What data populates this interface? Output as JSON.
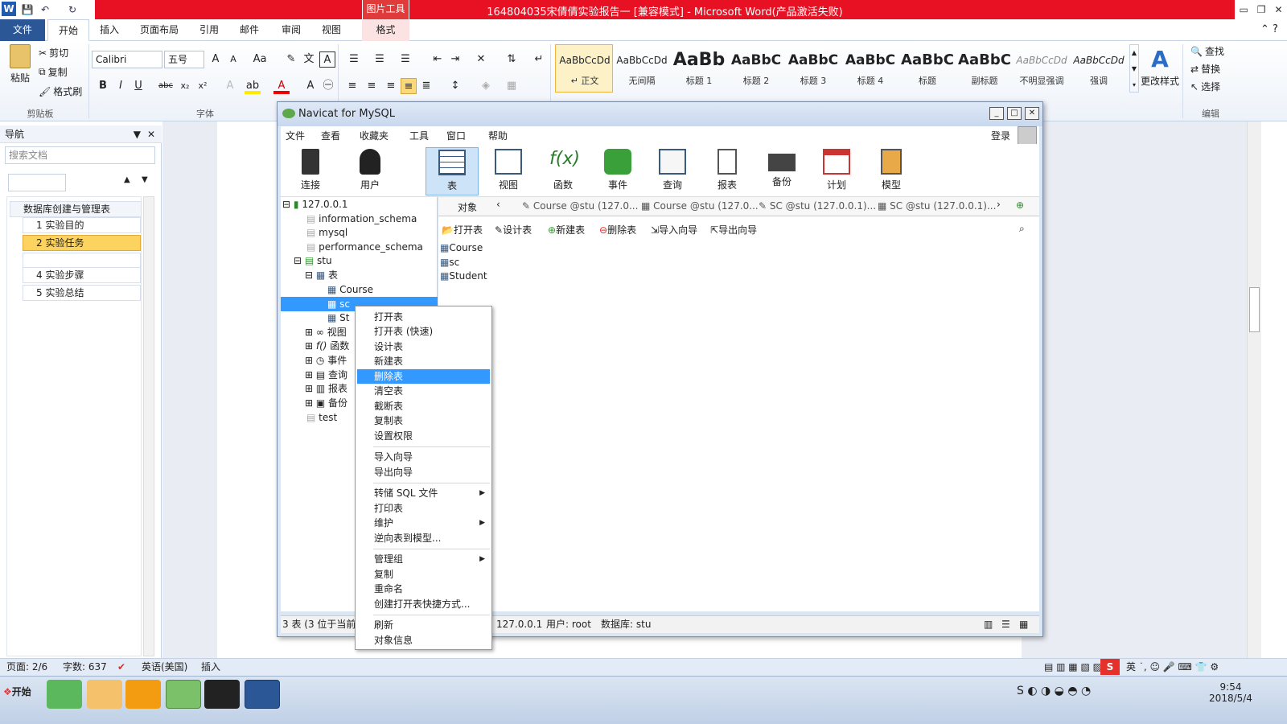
{
  "word": {
    "title": "164804035宋倩倩实验报告一 [兼容模式] - Microsoft Word(产品激活失败)",
    "picture_tools": "图片工具",
    "tabs": [
      "文件",
      "开始",
      "插入",
      "页面布局",
      "引用",
      "邮件",
      "审阅",
      "视图",
      "格式"
    ],
    "clipboard": {
      "paste": "粘贴",
      "cut": "剪切",
      "copy": "复制",
      "painter": "格式刷",
      "label": "剪贴板"
    },
    "font": {
      "name": "Calibri",
      "size": "五号",
      "label": "字体"
    },
    "styles": [
      {
        "preview": "AaBbCcDd",
        "name": "↵ 正文"
      },
      {
        "preview": "AaBbCcDd",
        "name": "无间隔"
      },
      {
        "preview": "AaBb",
        "name": "标题 1"
      },
      {
        "preview": "AaBbC",
        "name": "标题 2"
      },
      {
        "preview": "AaBbC",
        "name": "标题 3"
      },
      {
        "preview": "AaBbC",
        "name": "标题 4"
      },
      {
        "preview": "AaBbC",
        "name": "标题"
      },
      {
        "preview": "AaBbC",
        "name": "副标题"
      },
      {
        "preview": "AaBbCcDd",
        "name": "不明显强调"
      },
      {
        "preview": "AaBbCcDd",
        "name": "强调"
      }
    ],
    "change_styles": "更改样式",
    "editing": {
      "find": "查找",
      "replace": "替换",
      "select": "选择",
      "label": "编辑"
    },
    "nav": {
      "title": "导航",
      "search_placeholder": "搜索文档",
      "items": [
        "数据库创建与管理表",
        "1 实验目的",
        "2 实验任务",
        "",
        "4 实验步骤",
        "5 实验总结"
      ]
    },
    "status": {
      "page": "页面: 2/6",
      "words": "字数: 637",
      "lang": "英语(美国)",
      "mode": "插入"
    },
    "clock": {
      "time": "9:54",
      "date": "2018/5/4"
    },
    "start": "开始"
  },
  "navicat": {
    "title": "Navicat for MySQL",
    "login": "登录",
    "menu": [
      "文件",
      "查看",
      "收藏夹",
      "工具",
      "窗口",
      "帮助"
    ],
    "toolbar": [
      "连接",
      "用户",
      "表",
      "视图",
      "函数",
      "事件",
      "查询",
      "报表",
      "备份",
      "计划",
      "模型"
    ],
    "tree": [
      {
        "label": "127.0.0.1"
      },
      {
        "label": "information_schema"
      },
      {
        "label": "mysql"
      },
      {
        "label": "performance_schema"
      },
      {
        "label": "stu"
      },
      {
        "label": "表"
      },
      {
        "label": "Course"
      },
      {
        "label": "sc"
      },
      {
        "label": "St"
      },
      {
        "label": "视图"
      },
      {
        "label": "函数"
      },
      {
        "label": "事件"
      },
      {
        "label": "查询"
      },
      {
        "label": "报表"
      },
      {
        "label": "备份"
      },
      {
        "label": "test"
      }
    ],
    "tabs": [
      "对象",
      "Course @stu (127.0...",
      "Course @stu (127.0...",
      "SC @stu (127.0.0.1)...",
      "SC @stu (127.0.0.1)..."
    ],
    "obj_toolbar": [
      "打开表",
      "设计表",
      "新建表",
      "删除表",
      "导入向导",
      "导出向导"
    ],
    "objects": [
      "Course",
      "sc",
      "Student"
    ],
    "status": {
      "left": "3 表 (3 位于当前",
      "conn": "127.0.0.1",
      "user": "用户: root",
      "db": "数据库: stu"
    }
  },
  "context_menu": {
    "items": [
      "打开表",
      "打开表 (快速)",
      "设计表",
      "新建表",
      "删除表",
      "清空表",
      "截断表",
      "复制表",
      "设置权限",
      "导入向导",
      "导出向导",
      "转储 SQL 文件",
      "打印表",
      "维护",
      "逆向表到模型...",
      "管理组",
      "复制",
      "重命名",
      "创建打开表快捷方式...",
      "刷新",
      "对象信息"
    ],
    "selected": "删除表"
  }
}
